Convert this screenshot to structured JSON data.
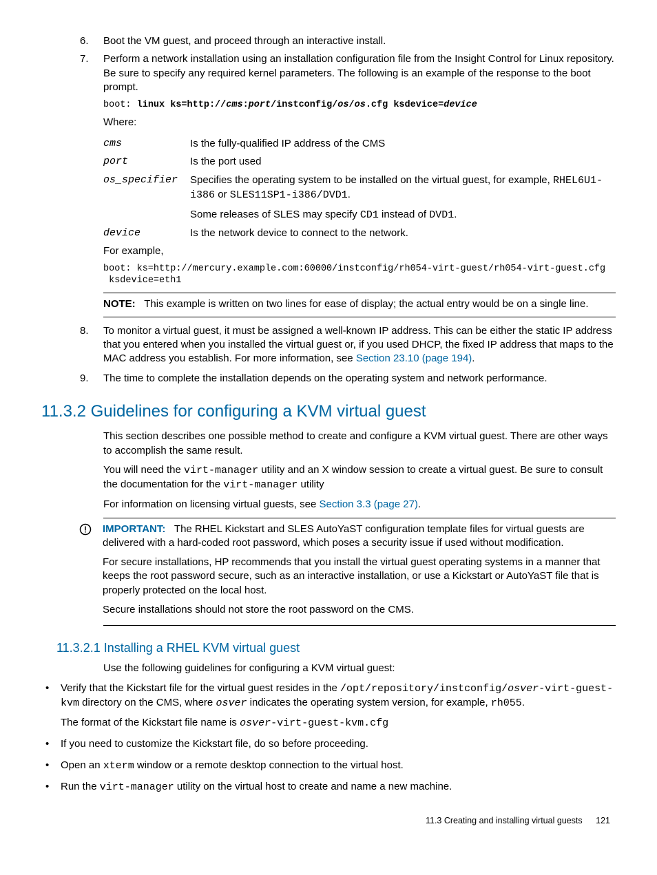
{
  "list": {
    "i6": {
      "num": "6.",
      "text": "Boot the VM guest, and proceed through an interactive install."
    },
    "i7": {
      "num": "7.",
      "text": "Perform a network installation using an installation configuration file from the Insight Control for Linux repository. Be sure to specify any required kernel parameters. The following is an example of the response to the boot prompt.",
      "boot_prefix": "boot:",
      "boot_cmd": "linux ks=http://",
      "boot_cms": "cms",
      "boot_colon": ":",
      "boot_port": "port",
      "boot_mid": "/instconfig/",
      "boot_os1": "os",
      "boot_slash": "/",
      "boot_os2": "os",
      "boot_cfg": ".cfg ksdevice=",
      "boot_device": "device",
      "where": "Where:",
      "defs": {
        "cms": {
          "term": "cms",
          "desc": "Is the fully-qualified IP address of the CMS"
        },
        "port": {
          "term": "port",
          "desc": "Is the port used"
        },
        "os": {
          "term": "os_specifier",
          "d1a": "Specifies the operating system to be installed on the virtual guest, for example, ",
          "d1b": "RHEL6U1-i386",
          "d1c": " or ",
          "d1d": "SLES11SP1-i386/DVD1",
          "d1e": ".",
          "d2a": "Some releases of SLES may specify ",
          "d2b": "CD1",
          "d2c": " instead of ",
          "d2d": "DVD1",
          "d2e": "."
        },
        "device": {
          "term": "device",
          "desc": "Is the network device to connect to the network."
        }
      },
      "for_example": "For example,",
      "example_line1": "boot: ks=http://mercury.example.com:60000/instconfig/rh054-virt-guest/rh054-virt-guest.cfg",
      "example_line2": " ksdevice=eth1",
      "note_label": "NOTE:",
      "note_text": "This example is written on two lines for ease of display; the actual entry would be on a single line."
    },
    "i8": {
      "num": "8.",
      "t1": "To monitor a virtual guest, it must be assigned a well-known IP address. This can be either the static IP address that you entered when you installed the virtual guest or, if you used DHCP, the fixed IP address that maps to the MAC address you establish. For more information, see ",
      "link": "Section 23.10 (page 194)",
      "t2": "."
    },
    "i9": {
      "num": "9.",
      "text": "The time to complete the installation depends on the operating system and network performance."
    }
  },
  "h2": "11.3.2 Guidelines for configuring a KVM virtual guest",
  "p1": "This section describes one possible method to create and configure a KVM virtual guest. There are other ways to accomplish the same result.",
  "p2a": "You will need the ",
  "p2b": "virt-manager",
  "p2c": " utility and an X window session to create a virtual guest. Be sure to consult the documentation for the ",
  "p2d": "virt-manager",
  "p2e": " utility",
  "p3a": "For information on licensing virtual guests, see ",
  "p3link": "Section 3.3 (page 27)",
  "p3b": ".",
  "important": {
    "label": "IMPORTANT:",
    "p1": "The RHEL Kickstart and SLES AutoYaST configuration template files for virtual guests are delivered with a hard-coded root password, which poses a security issue if used without modification.",
    "p2": "For secure installations, HP recommends that you install the virtual guest operating systems in a manner that keeps the root password secure, such as an interactive installation, or use a Kickstart or AutoYaST file that is properly protected on the local host.",
    "p3": "Secure installations should not store the root password on the CMS."
  },
  "h3": "11.3.2.1 Installing a RHEL KVM virtual guest",
  "h3p1": "Use the following guidelines for configuring a KVM virtual guest:",
  "bullets": {
    "b1": {
      "t1": "Verify that the Kickstart file for the virtual guest resides in the ",
      "path1": "/opt/repository/instconfig/",
      "osver1": "osver",
      "path2": "-virt-guest-kvm",
      "t2": " directory on the CMS, where ",
      "osver2": "osver",
      "t3": " indicates the operating system version, for example, ",
      "ex": "rh055",
      "t4": ".",
      "t5": "The format of the Kickstart file name is ",
      "osver3": "osver",
      "path3": "-virt-guest-kvm.cfg"
    },
    "b2": "If you need to customize the Kickstart file, do so before proceeding.",
    "b3a": "Open an ",
    "b3b": "xterm",
    "b3c": " window or a remote desktop connection to the virtual host.",
    "b4a": "Run the ",
    "b4b": "virt-manager",
    "b4c": " utility on the virtual host to create and name a new machine."
  },
  "footer": {
    "section": "11.3 Creating and installing virtual guests",
    "page": "121"
  }
}
